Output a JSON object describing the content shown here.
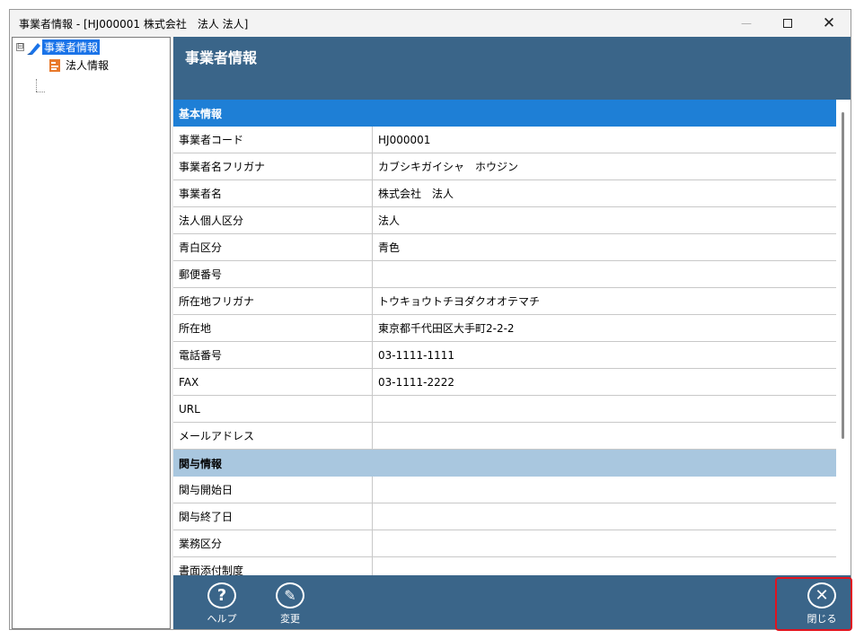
{
  "window": {
    "title": "事業者情報 - [HJ000001 株式会社　法人 法人]",
    "controls": {
      "minimize": "—",
      "close": "✕"
    }
  },
  "tree": {
    "root": {
      "toggle": "⊟",
      "label": "事業者情報",
      "icon": "pen-icon"
    },
    "child": {
      "label": "法人情報",
      "icon": "document-icon"
    }
  },
  "panel": {
    "title": "事業者情報"
  },
  "sections": {
    "basic": "基本情報",
    "involvement": "関与情報"
  },
  "basic_rows": [
    {
      "label": "事業者コード",
      "value": "HJ000001"
    },
    {
      "label": "事業者名フリガナ",
      "value": "カブシキガイシャ　ホウジン"
    },
    {
      "label": "事業者名",
      "value": "株式会社　法人"
    },
    {
      "label": "法人個人区分",
      "value": "法人"
    },
    {
      "label": "青白区分",
      "value": "青色"
    },
    {
      "label": "郵便番号",
      "value": ""
    },
    {
      "label": "所在地フリガナ",
      "value": "トウキョウトチヨダクオオテマチ"
    },
    {
      "label": "所在地",
      "value": "東京都千代田区大手町2-2-2"
    },
    {
      "label": "電話番号",
      "value": "03-1111-1111"
    },
    {
      "label": "FAX",
      "value": "03-1111-2222"
    },
    {
      "label": "URL",
      "value": ""
    },
    {
      "label": "メールアドレス",
      "value": ""
    }
  ],
  "involvement_rows": [
    {
      "label": "関与開始日",
      "value": ""
    },
    {
      "label": "関与終了日",
      "value": ""
    },
    {
      "label": "業務区分",
      "value": ""
    },
    {
      "label": "書面添付制度",
      "value": ""
    }
  ],
  "footer": {
    "help": {
      "label": "ヘルプ",
      "glyph": "?"
    },
    "edit": {
      "label": "変更",
      "glyph": "✎"
    },
    "close": {
      "label": "閉じる",
      "glyph": "✕"
    }
  },
  "colors": {
    "header_bg": "#3a6589",
    "section_primary": "#1e7fd6",
    "section_secondary": "#a9c7df",
    "tree_selected": "#1a73e8",
    "highlight_border": "#e0141e"
  }
}
